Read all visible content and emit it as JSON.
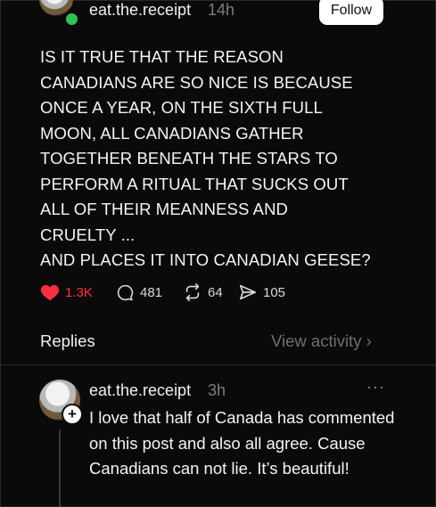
{
  "post": {
    "username": "eat.the.receipt",
    "timestamp": "14h",
    "follow_label": "Follow",
    "text": "IS IT TRUE THAT THE REASON\nCANADIANS ARE SO NICE IS BECAUSE\nONCE A YEAR, ON THE SIXTH FULL\nMOON, ALL CANADIANS GATHER\nTOGETHER BENEATH THE STARS TO\nPERFORM A RITUAL THAT SUCKS OUT\nALL OF THEIR MEANNESS AND\nCRUELTY ...\nAND PLACES IT INTO CANADIAN GEESE?",
    "likes": "1.3K",
    "comments": "481",
    "reposts": "64",
    "shares": "105"
  },
  "replies_section": {
    "label": "Replies",
    "view_activity": "View activity"
  },
  "reply": {
    "username": "eat.the.receipt",
    "timestamp": "3h",
    "text": "I love that half of Canada has commented on this post and also all agree. Cause Canadians can not lie. It’s beautiful!"
  },
  "icons": {
    "like": "heart-icon",
    "comment": "comment-bubble-icon",
    "repost": "repost-icon",
    "share": "send-icon",
    "more": "more-icon",
    "chevron": "chevron-right-icon"
  },
  "colors": {
    "background": "#0a0a0a",
    "like": "#ff3040",
    "online": "#31c24f",
    "muted": "#7e7e7e"
  }
}
